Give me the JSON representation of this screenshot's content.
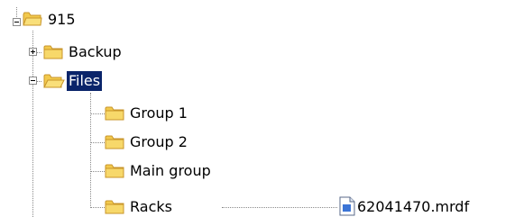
{
  "tree": {
    "root": {
      "label": "915",
      "icon": "folder-icon",
      "expanded": true
    },
    "children": [
      {
        "label": "Backup",
        "icon": "folder-icon",
        "expanded": false
      },
      {
        "label": "Files",
        "icon": "folder-open-icon",
        "expanded": true,
        "selected": true,
        "children": [
          {
            "label": "Group 1",
            "icon": "folder-icon"
          },
          {
            "label": "Group 2",
            "icon": "folder-icon"
          },
          {
            "label": "Main group",
            "icon": "folder-icon"
          },
          {
            "label": "Racks",
            "icon": "folder-icon",
            "file": {
              "label": "62041470.mrdf",
              "icon": "document-icon"
            }
          }
        ]
      }
    ]
  },
  "colors": {
    "selection_bg": "#0a246a",
    "selection_text": "#ffffff",
    "folder": "#f2c94c",
    "lines": "#8a8a8a"
  }
}
